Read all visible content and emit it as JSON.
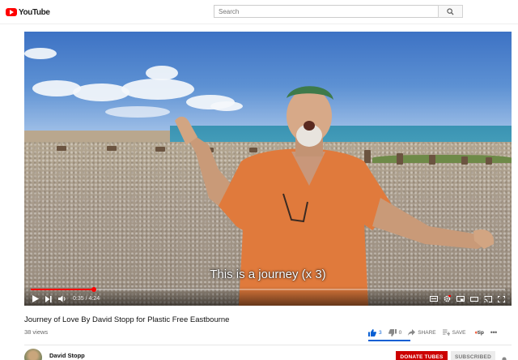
{
  "header": {
    "logo_text": "YouTube",
    "search_placeholder": "Search"
  },
  "player": {
    "subtitle": "This is a journey (x 3)",
    "current_time": "0:35",
    "duration": "4:24",
    "time_display": "0:35 / 4:24",
    "progress_fraction": 0.1326
  },
  "video": {
    "title": "Journey of Love By David Stopp for Plastic Free Eastbourne",
    "views": "38 views"
  },
  "actions": {
    "like_count": "3",
    "dislike_count": "0",
    "share_label": "SHARE",
    "save_label": "SAVE",
    "tip_label": "tip",
    "like_fraction": 1.0
  },
  "channel": {
    "name": "David Stopp",
    "donate_label": "DONATE TUBES",
    "subscribed_label": "SUBSCRIBED"
  },
  "colors": {
    "brand_red": "#ff0000",
    "like_blue": "#065fd4",
    "donate_red": "#cc0000"
  }
}
